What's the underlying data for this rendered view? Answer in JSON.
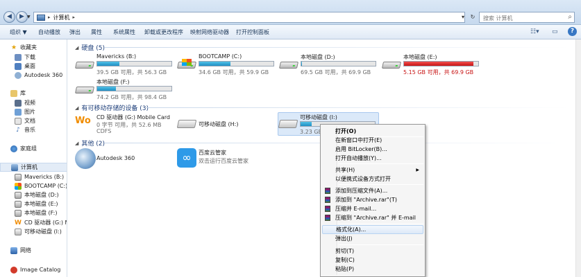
{
  "address": {
    "computer_label": "计算机",
    "search_placeholder": "搜索 计算机"
  },
  "toolbar": {
    "organize": "组织 ▼",
    "autoplay": "自动播放",
    "eject": "弹出",
    "properties": "属性",
    "system_properties": "系统属性",
    "uninstall": "卸载或更改程序",
    "map_drive": "映射网络驱动器",
    "control_panel": "打开控制面板",
    "help": "?"
  },
  "nav": {
    "favorites": "收藏夹",
    "downloads": "下载",
    "desktop": "桌面",
    "autodesk": "Autodesk 360",
    "libraries": "库",
    "videos": "视频",
    "pictures": "图片",
    "documents": "文档",
    "music": "音乐",
    "homegroup": "家庭组",
    "computer": "计算机",
    "drive_b": "Mavericks (B:)",
    "drive_c": "BOOTCAMP (C:)",
    "drive_d": "本地磁盘 (D:)",
    "drive_e": "本地磁盘 (E:)",
    "drive_f": "本地磁盘 (F:)",
    "drive_g": "CD 驱动器 (G:) Mo",
    "drive_i": "可移动磁盘 (I:)",
    "network": "网络",
    "image_catalog": "Image Catalog"
  },
  "groups": {
    "hdd": "硬盘 (5)",
    "removable": "有可移动存储的设备 (3)",
    "other": "其他 (2)"
  },
  "drives": [
    {
      "name": "Mavericks (B:)",
      "free": "39.5 GB 可用，共 56.3 GB",
      "used_pct": 30
    },
    {
      "name": "BOOTCAMP (C:)",
      "free": "34.6 GB 可用，共 59.9 GB",
      "used_pct": 42
    },
    {
      "name": "本地磁盘 (D:)",
      "free": "69.5 GB 可用，共 69.9 GB",
      "used_pct": 1
    },
    {
      "name": "本地磁盘 (E:)",
      "free": "5.15 GB 可用，共 69.9 GB",
      "used_pct": 93
    },
    {
      "name": "本地磁盘 (F:)",
      "free": "74.2 GB 可用，共 98.4 GB",
      "used_pct": 25
    }
  ],
  "removable": {
    "cd_name": "CD 驱动器 (G:) Mobile Card",
    "cd_free": "0 字节 可用，共 52.6 MB",
    "cd_fs": "CDFS",
    "h_name": "可移动磁盘 (H:)",
    "i_name": "可移动磁盘 (I:)",
    "i_free": "3.23 GB",
    "i_used_pct": 15
  },
  "other": {
    "autodesk": "Autodesk 360",
    "baidu_name": "百度云管家",
    "baidu_sub": "双击运行百度云管家"
  },
  "context_menu": {
    "open": "打开(O)",
    "open_new_window": "在新窗口中打开(E)",
    "bitlocker": "启用 BitLocker(B)...",
    "autoplay": "打开自动播放(Y)...",
    "share": "共享(H)",
    "portable": "以便携式设备方式打开",
    "add_archive": "添加到压缩文件(A)...",
    "add_rar": "添加到 \"Archive.rar\"(T)",
    "compress_email": "压缩并 E-mail...",
    "compress_rar_email": "压缩到 \"Archive.rar\" 并 E-mail",
    "format": "格式化(A)...",
    "eject": "弹出(J)",
    "cut": "剪切(T)",
    "copy": "复制(C)",
    "paste": "粘贴(P)"
  }
}
